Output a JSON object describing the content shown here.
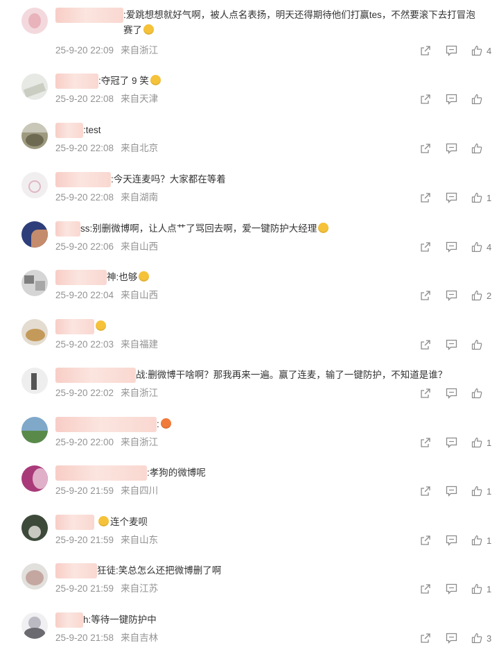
{
  "comments": [
    {
      "text": ":爱跳想想就好气啊，被人点名表扬，明天还得期待他们打赢tes，不然要滚下去打冒泡赛了",
      "emoji": "grin-sweat",
      "date": "25-9-20 22:09",
      "location": "来自浙江",
      "likes": "4"
    },
    {
      "text": ":夺冠了 9 笑",
      "emoji": "smile",
      "date": "25-9-20 22:08",
      "location": "来自天津",
      "likes": ""
    },
    {
      "text": ":test",
      "emoji": "",
      "date": "25-9-20 22:08",
      "location": "来自北京",
      "likes": ""
    },
    {
      "text": ":今天连麦吗？大家都在等着",
      "emoji": "",
      "date": "25-9-20 22:08",
      "location": "来自湖南",
      "likes": "1"
    },
    {
      "text": "ss:别删微博啊，让人点艹了骂回去啊，爱一键防护大经理",
      "emoji": "scream",
      "date": "25-9-20 22:06",
      "location": "来自山西",
      "likes": "4"
    },
    {
      "text": "神:也够",
      "emoji": "cry",
      "date": "25-9-20 22:04",
      "location": "来自山西",
      "likes": "2"
    },
    {
      "text": "",
      "emoji": "shocked",
      "date": "25-9-20 22:03",
      "location": "来自福建",
      "likes": ""
    },
    {
      "text": "战:删微博干啥啊？那我再来一遍。赢了连麦，输了一键防护，不知道是谁？",
      "emoji": "",
      "date": "25-9-20 22:02",
      "location": "来自浙江",
      "likes": ""
    },
    {
      "text": ":",
      "emoji": "laugh-red",
      "date": "25-9-20 22:00",
      "location": "来自浙江",
      "likes": "1"
    },
    {
      "text": ":孝狗的微博呢",
      "emoji": "",
      "date": "25-9-20 21:59",
      "location": "来自四川",
      "likes": "1"
    },
    {
      "text": "连个麦呗",
      "emoji": "shocked",
      "date": "25-9-20 21:59",
      "location": "来自山东",
      "likes": "1"
    },
    {
      "text": "狂徒:笑总怎么还把微博删了啊",
      "emoji": "",
      "date": "25-9-20 21:59",
      "location": "来自江苏",
      "likes": "1"
    },
    {
      "text": "h:等待一键防护中",
      "emoji": "",
      "date": "25-9-20 21:58",
      "location": "来自吉林",
      "likes": "3"
    }
  ],
  "icons": {
    "share": "share-icon",
    "comment": "comment-icon",
    "like": "thumbs-up-icon"
  },
  "colors": {
    "meta": "#939393",
    "text": "#333333",
    "icon": "#8a8a8a"
  }
}
